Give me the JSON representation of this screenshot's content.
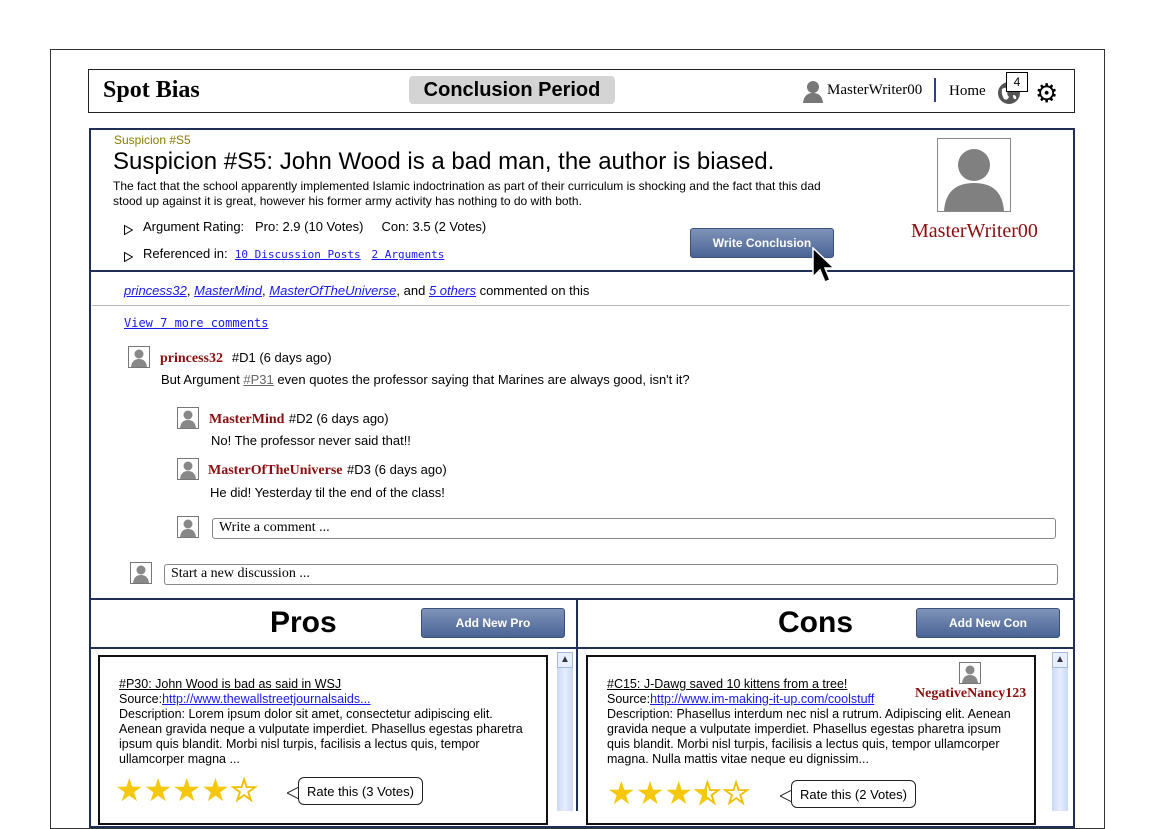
{
  "header": {
    "brand": "Spot Bias",
    "period": "Conclusion Period",
    "username": "MasterWriter00",
    "home_label": "Home",
    "notification_count": "4"
  },
  "suspicion": {
    "tag": "Suspicion #S5",
    "title": "Suspicion #S5: John Wood is a bad man, the author is biased.",
    "description": "The fact that the school apparently implemented Islamic indoctrination as part of their curriculum is shocking and the fact that this dad stood up against it is great, however his former army activity has nothing to do with both.",
    "rating_label": "Argument Rating:",
    "pro_rating": "Pro: 2.9 (10 Votes)",
    "con_rating": "Con: 3.5 (2 Votes)",
    "referenced_label": "Referenced in:",
    "ref_discussion": "10 Discussion Posts",
    "ref_arguments": "2 Arguments",
    "write_conclusion": "Write Conclusion",
    "author": "MasterWriter00"
  },
  "comments_summary": {
    "user1": "princess32",
    "user2": "MasterMind",
    "user3": "MasterOfTheUniverse",
    "and": ", and",
    "others": "5 others",
    "suffix": "commented on this",
    "view_more": "View 7 more comments"
  },
  "discussion": {
    "main": {
      "user": "princess32",
      "meta": "#D1 (6 days ago)",
      "text_before": "But Argument",
      "link": "#P31",
      "text_after": "even quotes the professor saying that Marines are always good, isn't it?"
    },
    "replies": [
      {
        "user": "MasterMind",
        "meta": "#D2 (6 days ago)",
        "text": "No! The professor never said that!!"
      },
      {
        "user": "MasterOfTheUniverse",
        "meta": "#D3 (6 days ago)",
        "text": "He did! Yesterday til the end of the class!"
      }
    ],
    "reply_placeholder": "Write a comment ...",
    "new_discussion_placeholder": "Start a new discussion ..."
  },
  "pros": {
    "heading": "Pros",
    "add_button": "Add New Pro",
    "card": {
      "title": "#P30: John Wood is bad as said in WSJ",
      "source_label": "Source:",
      "source_url": "http://www.thewallstreetjournalsaids...",
      "description": "Description: Lorem ipsum dolor sit amet, consectetur adipiscing elit. Aenean gravida neque a vulputate imperdiet. Phasellus egestas pharetra ipsum quis blandit. Morbi nisl turpis, facilisis a lectus quis, tempor ullamcorper magna ...",
      "rating": 4,
      "rate_label": "Rate this (3 Votes)"
    }
  },
  "cons": {
    "heading": "Cons",
    "add_button": "Add New Con",
    "card": {
      "title": "#C15: J-Dawg saved 10 kittens from a tree!",
      "source_label": "Source:",
      "source_url": "http://www.im-making-it-up.com/coolstuff",
      "author": "NegativeNancy123",
      "description": "Description: Phasellus interdum nec nisl a rutrum. Adipiscing elit. Aenean gravida neque a vulputate imperdiet. Phasellus egestas pharetra ipsum quis blandit. Morbi nisl turpis, facilisis a lectus quis, tempor ullamcorper magna. Nulla mattis vitae neque eu dignissim...",
      "rating": 3.5,
      "rate_label": "Rate this (2 Votes)"
    }
  },
  "colors": {
    "accent_blue": "#4a6496",
    "username_red": "#8b0e0e",
    "star_yellow": "#f6c80c",
    "border_navy": "#1f2f56"
  }
}
